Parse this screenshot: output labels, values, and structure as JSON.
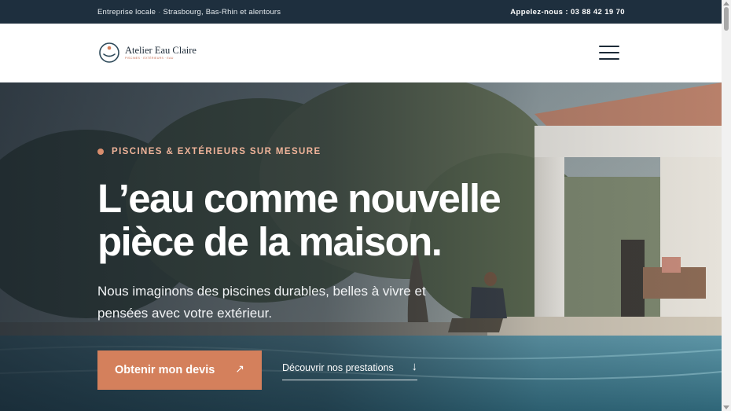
{
  "topbar": {
    "location_prefix": "Entreprise locale",
    "separator": "·",
    "location": "Strasbourg, Bas-Rhin et alentours",
    "phone": "Appelez-nous : 03 88 42 19 70"
  },
  "header": {
    "logo_name": "Atelier Eau Claire",
    "logo_tagline": "PISCINES · EXTÉRIEURS · EAU",
    "menu_icon": "hamburger-menu-icon"
  },
  "hero": {
    "eyebrow": "PISCINES & EXTÉRIEURS SUR MESURE",
    "title_line1": "L’eau comme nouvelle",
    "title_line2": "pièce de la maison.",
    "subtitle_line1": "Nous imaginons des piscines durables, belles à vivre et",
    "subtitle_line2": "pensées avec votre extérieur.",
    "cta_label": "Obtenir mon devis",
    "cta_arrow": "↗",
    "secondary_label": "Découvrir nos prestations",
    "secondary_arrow": "↓"
  },
  "colors": {
    "topbar_bg": "#1e2f3e",
    "accent": "#d4805c",
    "eyebrow_text": "#f0b49a",
    "navy": "#1d2b38"
  }
}
